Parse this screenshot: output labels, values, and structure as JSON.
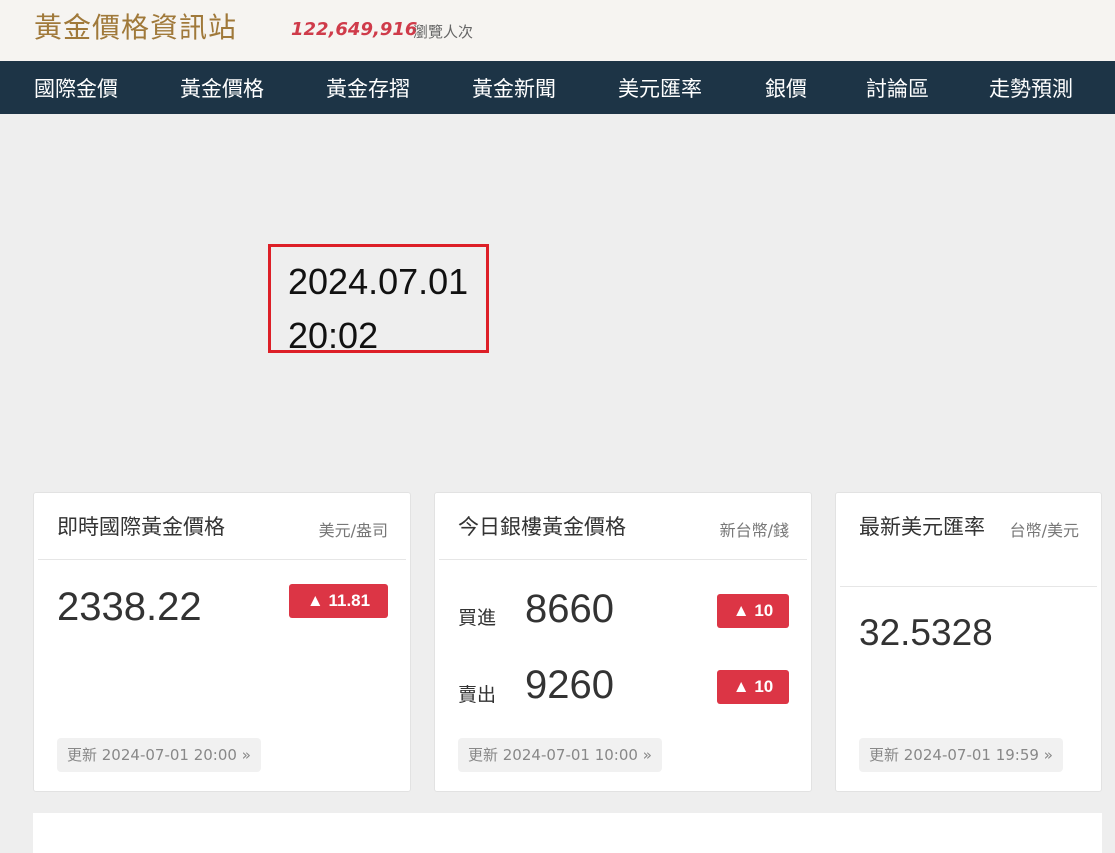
{
  "header": {
    "site_title": "黃金價格資訊站",
    "visit_count": "122,649,916",
    "visit_label": "瀏覽人次"
  },
  "nav": {
    "items": [
      "國際金價",
      "黃金價格",
      "黃金存摺",
      "黃金新聞",
      "美元匯率",
      "銀價",
      "討論區",
      "走勢預測"
    ]
  },
  "datetime": {
    "date": "2024.07.01",
    "time": "20:02"
  },
  "cards": {
    "intl_gold": {
      "title": "即時國際黃金價格",
      "unit": "美元/盎司",
      "price": "2338.22",
      "change": "▲ 11.81",
      "updated": "更新 2024-07-01 20:00 »"
    },
    "bank_gold": {
      "title": "今日銀樓黃金價格",
      "unit": "新台幣/錢",
      "buy_label": "買進",
      "buy_price": "8660",
      "buy_change": "▲ 10",
      "sell_label": "賣出",
      "sell_price": "9260",
      "sell_change": "▲ 10",
      "updated": "更新 2024-07-01 10:00 »"
    },
    "usd_rate": {
      "title": "最新美元匯率",
      "unit": "台幣/美元",
      "rate": "32.5328",
      "updated": "更新 2024-07-01 19:59 »"
    }
  },
  "colors": {
    "nav_bg": "#1d3446",
    "title_gold": "#a0793a",
    "accent_red": "#dc3545",
    "frame_red": "#dd1f27"
  }
}
